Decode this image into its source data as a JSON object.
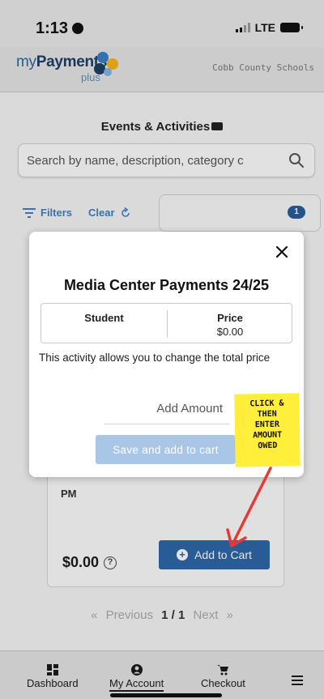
{
  "status_bar": {
    "time": "1:13",
    "network": "LTE"
  },
  "header": {
    "logo_my": "my",
    "logo_payments": "Payments",
    "logo_plus": "plus",
    "district": "Cobb County Schools",
    "logo_colors": [
      "#3b7dc4",
      "#f4b41a",
      "#1d3f66",
      "#7fb4e0"
    ]
  },
  "main": {
    "title": "Events & Activities",
    "search": {
      "placeholder": "Search by name, description, category c"
    },
    "filters_label": "Filters",
    "clear_label": "Clear",
    "cart_count": "1",
    "event_card": {
      "time_fragment": "PM",
      "price": "$0.00",
      "help": "?",
      "add_to_cart_label": "Add to Cart"
    },
    "pagination": {
      "prev": "Previous",
      "current": "1 / 1",
      "next": "Next"
    }
  },
  "modal": {
    "title": "Media Center Payments 24/25",
    "table": {
      "col_student": "Student",
      "col_price": "Price",
      "price_value": "$0.00"
    },
    "description": "This activity allows you to change the total price",
    "amount_placeholder": "Add Amount",
    "save_label": "Save and add to cart"
  },
  "annotation": {
    "note_text": "CLICK &\nTHEN\nENTER\nAMOUNT\nOWED"
  },
  "bottom_nav": {
    "dashboard": "Dashboard",
    "account": "My Account",
    "checkout": "Checkout"
  },
  "colors": {
    "brand_blue": "#2e67a8",
    "link_blue": "#3f7fbf",
    "disabled_blue": "#aac6e6",
    "note_yellow": "#ffef3a",
    "arrow_red": "#e53935"
  }
}
